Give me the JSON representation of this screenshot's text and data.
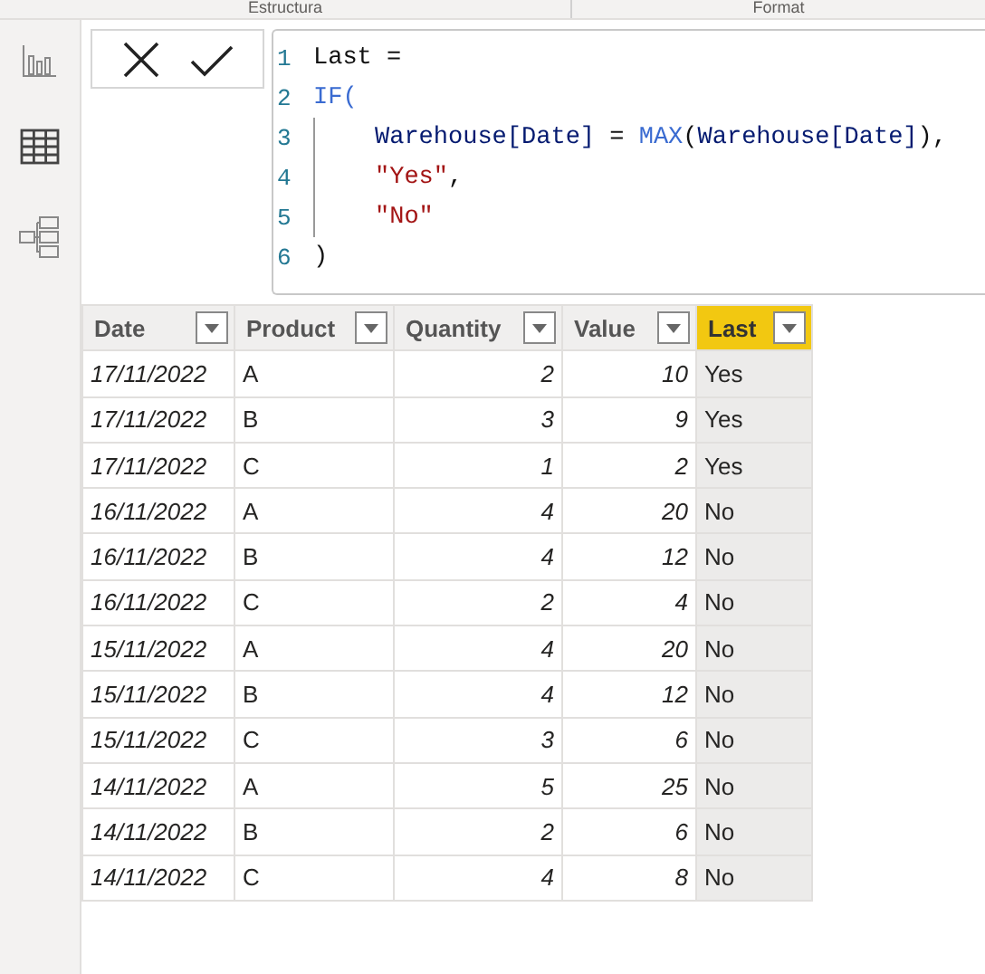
{
  "ribbon": {
    "groups": [
      "Estructura",
      "Format"
    ]
  },
  "formula_bar": {
    "lines": [
      {
        "number": "1",
        "indented": false,
        "tokens": [
          {
            "text": "Last =",
            "kind": "plain"
          }
        ]
      },
      {
        "number": "2",
        "indented": false,
        "tokens": [
          {
            "text": "IF(",
            "kind": "function"
          }
        ]
      },
      {
        "number": "3",
        "indented": true,
        "tokens": [
          {
            "text": "Warehouse[Date]",
            "kind": "column"
          },
          {
            "text": " = ",
            "kind": "plain"
          },
          {
            "text": "MAX",
            "kind": "function"
          },
          {
            "text": "(",
            "kind": "plain"
          },
          {
            "text": "Warehouse[Date]",
            "kind": "column"
          },
          {
            "text": "),",
            "kind": "plain"
          }
        ]
      },
      {
        "number": "4",
        "indented": true,
        "tokens": [
          {
            "text": "\"Yes\"",
            "kind": "string"
          },
          {
            "text": ",",
            "kind": "plain"
          }
        ]
      },
      {
        "number": "5",
        "indented": true,
        "tokens": [
          {
            "text": "\"No\"",
            "kind": "string"
          }
        ]
      },
      {
        "number": "6",
        "indented": false,
        "tokens": [
          {
            "text": ")",
            "kind": "plain"
          }
        ]
      }
    ]
  },
  "table": {
    "columns": [
      {
        "label": "Date",
        "kind": "date",
        "selected": false
      },
      {
        "label": "Product",
        "kind": "text",
        "selected": false
      },
      {
        "label": "Quantity",
        "kind": "number",
        "selected": false
      },
      {
        "label": "Value",
        "kind": "number",
        "selected": false
      },
      {
        "label": "Last",
        "kind": "text",
        "selected": true
      }
    ],
    "rows": [
      [
        "17/11/2022",
        "A",
        "2",
        "10",
        "Yes"
      ],
      [
        "17/11/2022",
        "B",
        "3",
        "9",
        "Yes"
      ],
      [
        "17/11/2022",
        "C",
        "1",
        "2",
        "Yes"
      ],
      [
        "16/11/2022",
        "A",
        "4",
        "20",
        "No"
      ],
      [
        "16/11/2022",
        "B",
        "4",
        "12",
        "No"
      ],
      [
        "16/11/2022",
        "C",
        "2",
        "4",
        "No"
      ],
      [
        "15/11/2022",
        "A",
        "4",
        "20",
        "No"
      ],
      [
        "15/11/2022",
        "B",
        "4",
        "12",
        "No"
      ],
      [
        "15/11/2022",
        "C",
        "3",
        "6",
        "No"
      ],
      [
        "14/11/2022",
        "A",
        "5",
        "25",
        "No"
      ],
      [
        "14/11/2022",
        "B",
        "2",
        "6",
        "No"
      ],
      [
        "14/11/2022",
        "C",
        "4",
        "8",
        "No"
      ]
    ]
  }
}
